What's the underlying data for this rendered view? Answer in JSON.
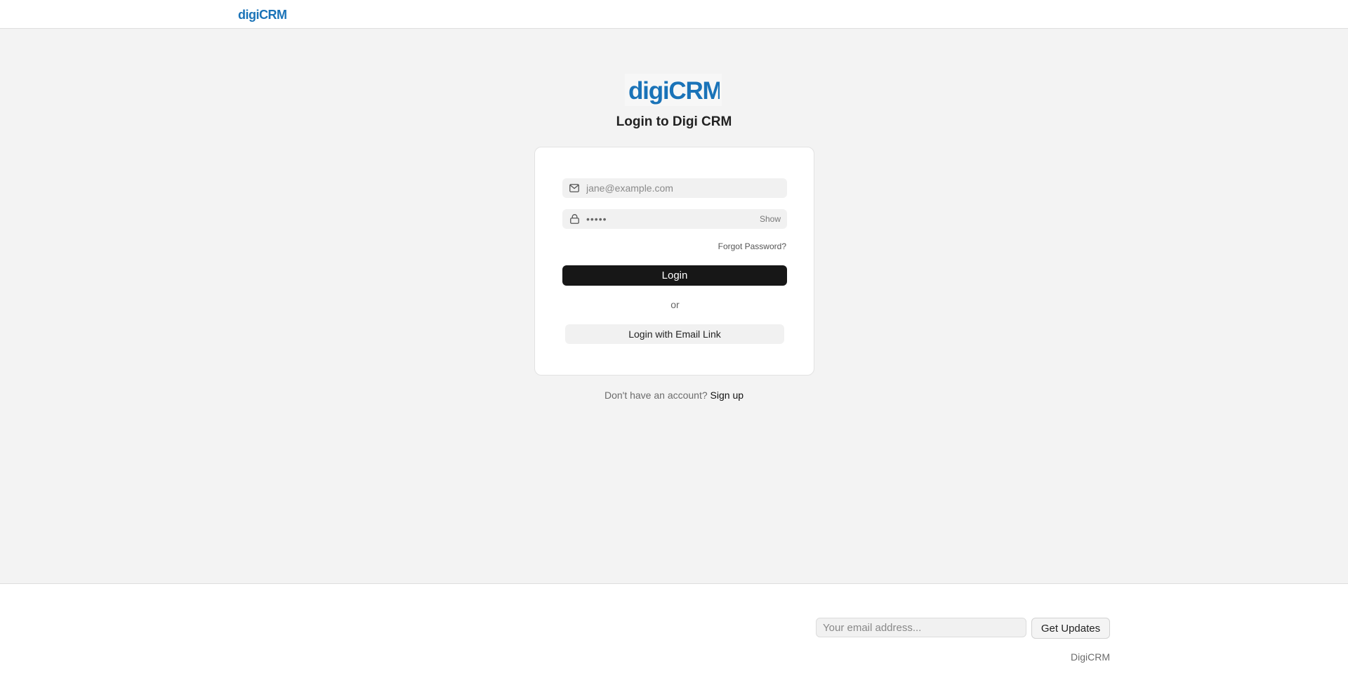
{
  "navbar": {
    "logo_text": "digiCRM"
  },
  "brand": {
    "logo_text": "digiCRM",
    "accent_color": "#1a73b8"
  },
  "login": {
    "title": "Login to Digi CRM",
    "email_placeholder": "jane@example.com",
    "email_icon": "mail-icon",
    "password_value": "•••••",
    "password_icon": "lock-icon",
    "show_label": "Show",
    "forgot_label": "Forgot Password?",
    "login_label": "Login",
    "or_label": "or",
    "email_link_label": "Login with Email Link"
  },
  "signup": {
    "prompt": "Don't have an account?",
    "link_label": "Sign up"
  },
  "footer": {
    "email_placeholder": "Your email address...",
    "updates_label": "Get Updates",
    "brand": "DigiCRM"
  }
}
